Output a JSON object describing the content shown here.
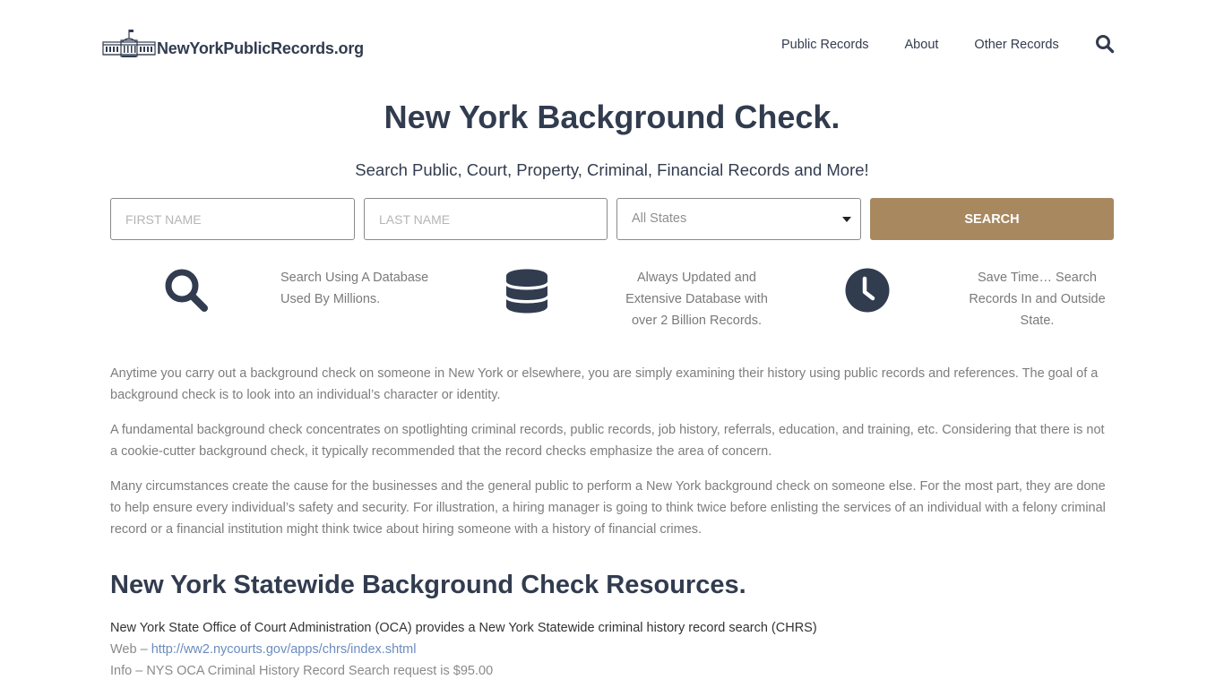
{
  "header": {
    "logo_text": "NewYorkPublicRecords.org",
    "nav": [
      {
        "label": "Public Records"
      },
      {
        "label": "About"
      },
      {
        "label": "Other Records"
      }
    ]
  },
  "hero": {
    "title": "New York Background Check.",
    "subtitle": "Search Public, Court, Property, Criminal, Financial Records and More!"
  },
  "search_form": {
    "first_name_placeholder": "FIRST NAME",
    "first_name_value": "",
    "last_name_placeholder": "LAST NAME",
    "last_name_value": "",
    "state_selected": "All States",
    "search_button": "SEARCH"
  },
  "features": [
    {
      "icon": "search-icon",
      "text": "Search Using A Database Used By Millions."
    },
    {
      "icon": "database-icon",
      "text": "Always Updated and Extensive Database with over 2 Billion Records."
    },
    {
      "icon": "clock-icon",
      "text": "Save Time… Search Records In and Outside State."
    }
  ],
  "content": {
    "paragraphs": [
      "Anytime you carry out a background check on someone in New York or elsewhere, you are simply examining their history using public records and references. The goal of a background check is to look into an individual’s character or identity.",
      "A fundamental background check concentrates on spotlighting criminal records, public records, job history, referrals, education, and training, etc. Considering that there is not a cookie-cutter background check, it typically recommended that the record checks emphasize the area of concern.",
      "Many circumstances create the cause for the businesses and the general public to perform a New York background check on someone else. For the most part, they are done to help ensure every individual’s safety and security. For illustration, a hiring manager is going to think twice before enlisting the services of an individual with a felony criminal record or a financial institution might think twice about hiring someone with a history of financial crimes."
    ]
  },
  "resources": {
    "section_title": "New York Statewide Background Check Resources.",
    "items": [
      {
        "title": "New York State Office of Court Administration (OCA) provides a New York Statewide criminal history record search (CHRS)",
        "web_label": "Web",
        "web_separator": " – ",
        "web_url": "http://ww2.nycourts.gov/apps/chrs/index.shtml",
        "info_label": "Info",
        "info_separator": " – ",
        "info_text": "NYS OCA Criminal History Record Search request is $95.00"
      }
    ]
  },
  "colors": {
    "primary_text": "#323c4f",
    "accent_button": "#a8885f",
    "body_text": "#7d7d7d",
    "link": "#6b8cbf"
  }
}
